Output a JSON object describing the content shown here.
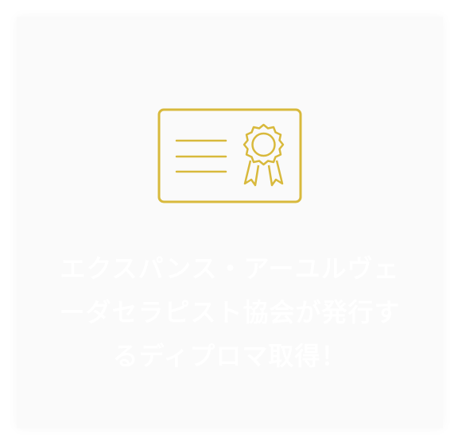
{
  "card": {
    "icon": "certificate-icon",
    "heading": "エクスパンス・アーユルヴェーダセラピスト協会が発行するディプロマ取得！"
  },
  "colors": {
    "card_background": "#fafafa",
    "icon_gold": "#d8b93c",
    "heading_text": "#ffffff"
  }
}
